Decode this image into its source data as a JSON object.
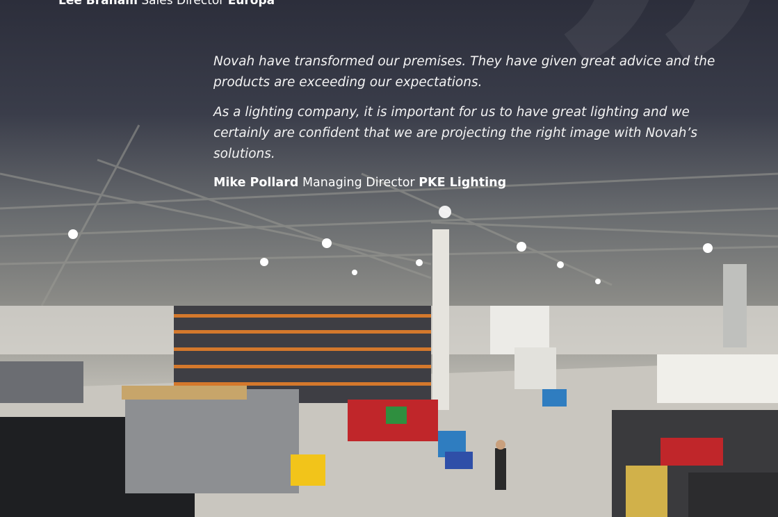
{
  "top_attribution": {
    "name": "Lee Braham",
    "role": "Sales Director",
    "company": "Europa"
  },
  "testimonial": {
    "paragraphs": [
      "Novah have transformed our premises. They have given great advice and the products are exceeding our expectations.",
      "As a lighting company, it is important for us to have great lighting and we certainly are confident that we are projecting the right image with Novah’s solutions."
    ],
    "name": "Mike Pollard",
    "role": "Managing Director",
    "company": "PKE Lighting"
  },
  "decor": {
    "quote_glyph": "”",
    "quote_glyph_icon": "quote-mark-icon"
  }
}
